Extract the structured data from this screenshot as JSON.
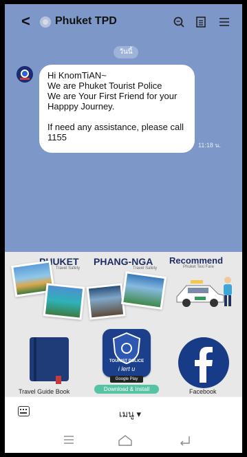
{
  "header": {
    "title": "Phuket TPD",
    "back_icon": "chevron-left-icon",
    "icons": [
      "search-icon",
      "notes-icon",
      "menu-icon"
    ]
  },
  "chat": {
    "date_label": "วันนี้",
    "message": "Hi KnomTiAN~\nWe are  Phuket Tourist Police\nWe are Your First Friend for your Happpy Journey.\n\nIf need any assistance, please call 1155",
    "time": "11:18 น."
  },
  "rich_menu": {
    "phuket_title": "PHUKET",
    "phuket_sub": "Travel Safety",
    "phangnga_title": "PHANG-NGA",
    "phangnga_sub": "Travel Safety",
    "recommend_title": "Recommend",
    "recommend_sub": "Phuket Texi Fare",
    "guide_label": "Travel Guide Book",
    "tourist_police_label": "TOURIST POLICE",
    "tourist_thai_text": "i lert u",
    "google_play": "Google Play",
    "download_label": "Download & Install",
    "facebook_label": "Facebook"
  },
  "bottom": {
    "menu_label": "เมนู ▾"
  },
  "colors": {
    "chat_background": "#7d98c8",
    "menu_background": "#e8e8e8",
    "title_blue": "#1d2d64",
    "facebook_blue": "#183b88",
    "download_green": "#56c3a4"
  }
}
